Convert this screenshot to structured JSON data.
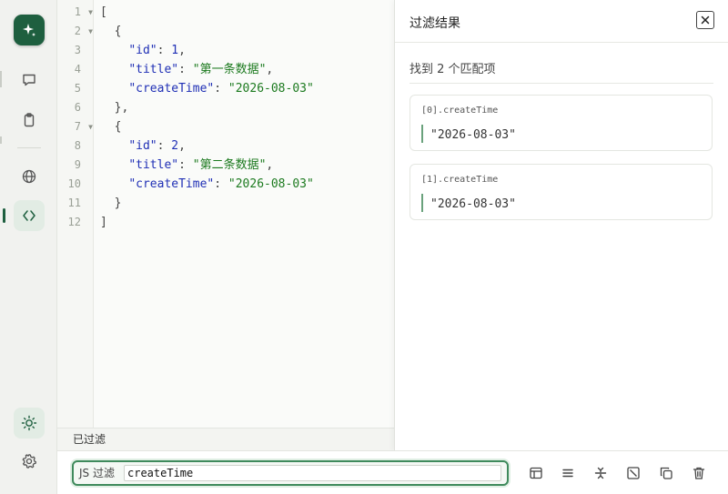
{
  "sidebar": {
    "logo_icon": "sparkle-icon",
    "items": [
      {
        "name": "chat",
        "icon": "chat-bubble-icon"
      },
      {
        "name": "clipboard",
        "icon": "clipboard-icon"
      },
      {
        "name": "globe",
        "icon": "globe-icon"
      },
      {
        "name": "code",
        "icon": "code-brackets-icon",
        "active": true
      }
    ],
    "bottom_items": [
      {
        "name": "theme",
        "icon": "sun-icon"
      },
      {
        "name": "settings",
        "icon": "gear-icon"
      }
    ]
  },
  "editor": {
    "line_numbers": [
      "1",
      "2",
      "3",
      "4",
      "5",
      "6",
      "7",
      "8",
      "9",
      "10",
      "11",
      "12"
    ],
    "code": [
      {
        "tokens": [
          {
            "t": "[",
            "c": "p"
          }
        ]
      },
      {
        "tokens": [
          {
            "t": "  {",
            "c": "p"
          }
        ]
      },
      {
        "tokens": [
          {
            "t": "    ",
            "c": "p"
          },
          {
            "t": "\"id\"",
            "c": "k"
          },
          {
            "t": ": ",
            "c": "p"
          },
          {
            "t": "1",
            "c": "n"
          },
          {
            "t": ",",
            "c": "p"
          }
        ]
      },
      {
        "tokens": [
          {
            "t": "    ",
            "c": "p"
          },
          {
            "t": "\"title\"",
            "c": "k"
          },
          {
            "t": ": ",
            "c": "p"
          },
          {
            "t": "\"第一条数据\"",
            "c": "s"
          },
          {
            "t": ",",
            "c": "p"
          }
        ]
      },
      {
        "tokens": [
          {
            "t": "    ",
            "c": "p"
          },
          {
            "t": "\"createTime\"",
            "c": "k"
          },
          {
            "t": ": ",
            "c": "p"
          },
          {
            "t": "\"2026-08-03\"",
            "c": "s"
          }
        ]
      },
      {
        "tokens": [
          {
            "t": "  },",
            "c": "p"
          }
        ]
      },
      {
        "tokens": [
          {
            "t": "  {",
            "c": "p"
          }
        ]
      },
      {
        "tokens": [
          {
            "t": "    ",
            "c": "p"
          },
          {
            "t": "\"id\"",
            "c": "k"
          },
          {
            "t": ": ",
            "c": "p"
          },
          {
            "t": "2",
            "c": "n"
          },
          {
            "t": ",",
            "c": "p"
          }
        ]
      },
      {
        "tokens": [
          {
            "t": "    ",
            "c": "p"
          },
          {
            "t": "\"title\"",
            "c": "k"
          },
          {
            "t": ": ",
            "c": "p"
          },
          {
            "t": "\"第二条数据\"",
            "c": "s"
          },
          {
            "t": ",",
            "c": "p"
          }
        ]
      },
      {
        "tokens": [
          {
            "t": "    ",
            "c": "p"
          },
          {
            "t": "\"createTime\"",
            "c": "k"
          },
          {
            "t": ": ",
            "c": "p"
          },
          {
            "t": "\"2026-08-03\"",
            "c": "s"
          }
        ]
      },
      {
        "tokens": [
          {
            "t": "  }",
            "c": "p"
          }
        ]
      },
      {
        "tokens": [
          {
            "t": "]",
            "c": "p"
          }
        ]
      }
    ],
    "fold_lines": [
      1,
      2,
      7
    ]
  },
  "status": {
    "text": "已过滤"
  },
  "panel": {
    "title": "过滤结果",
    "match_count": "找到 2 个匹配项",
    "results": [
      {
        "path": "[0].createTime",
        "value": "\"2026-08-03\""
      },
      {
        "path": "[1].createTime",
        "value": "\"2026-08-03\""
      }
    ]
  },
  "filter": {
    "label": "JS 过滤",
    "value": "createTime"
  },
  "toolbar": {
    "buttons": [
      {
        "name": "layout",
        "icon": "layout-icon"
      },
      {
        "name": "format",
        "icon": "align-lines-icon"
      },
      {
        "name": "compress",
        "icon": "strikethrough-icon"
      },
      {
        "name": "escape",
        "icon": "slash-box-icon"
      },
      {
        "name": "copy",
        "icon": "copy-icon"
      },
      {
        "name": "delete",
        "icon": "trash-icon"
      }
    ]
  },
  "colors": {
    "accent": "#1e5f3f",
    "key": "#1f2fb5",
    "string": "#1c7a1f"
  }
}
